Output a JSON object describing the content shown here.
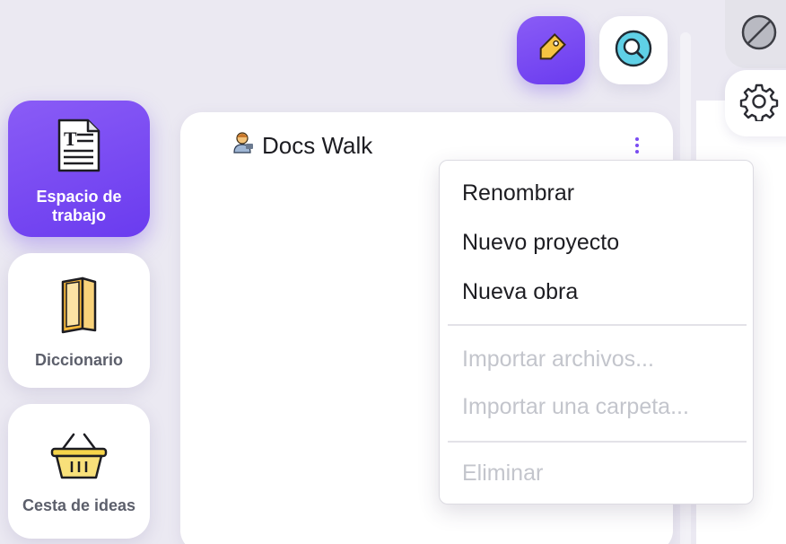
{
  "nav": {
    "items": [
      {
        "label": "Espacio de trabajo",
        "icon": "document-icon",
        "active": true
      },
      {
        "label": "Diccionario",
        "icon": "book-icon",
        "active": false
      },
      {
        "label": "Cesta de ideas",
        "icon": "basket-icon",
        "active": false
      }
    ]
  },
  "toolbar": {
    "tag_icon": "tag-icon",
    "search_icon": "search-icon",
    "disabled_icon": "prohibited-icon",
    "settings_icon": "gear-icon"
  },
  "document": {
    "title": "Docs Walk",
    "owner_icon": "person-at-desk-icon",
    "more_icon": "kebab-menu-icon"
  },
  "context_menu": {
    "rename": "Renombrar",
    "new_project": "Nuevo proyecto",
    "new_work": "Nueva obra",
    "import_files": "Importar archivos...",
    "import_folder": "Importar una carpeta...",
    "delete": "Eliminar"
  },
  "colors": {
    "accent": "#7a4cf2",
    "background": "#ebe9f2",
    "disabled_text": "#c3c5cc"
  }
}
